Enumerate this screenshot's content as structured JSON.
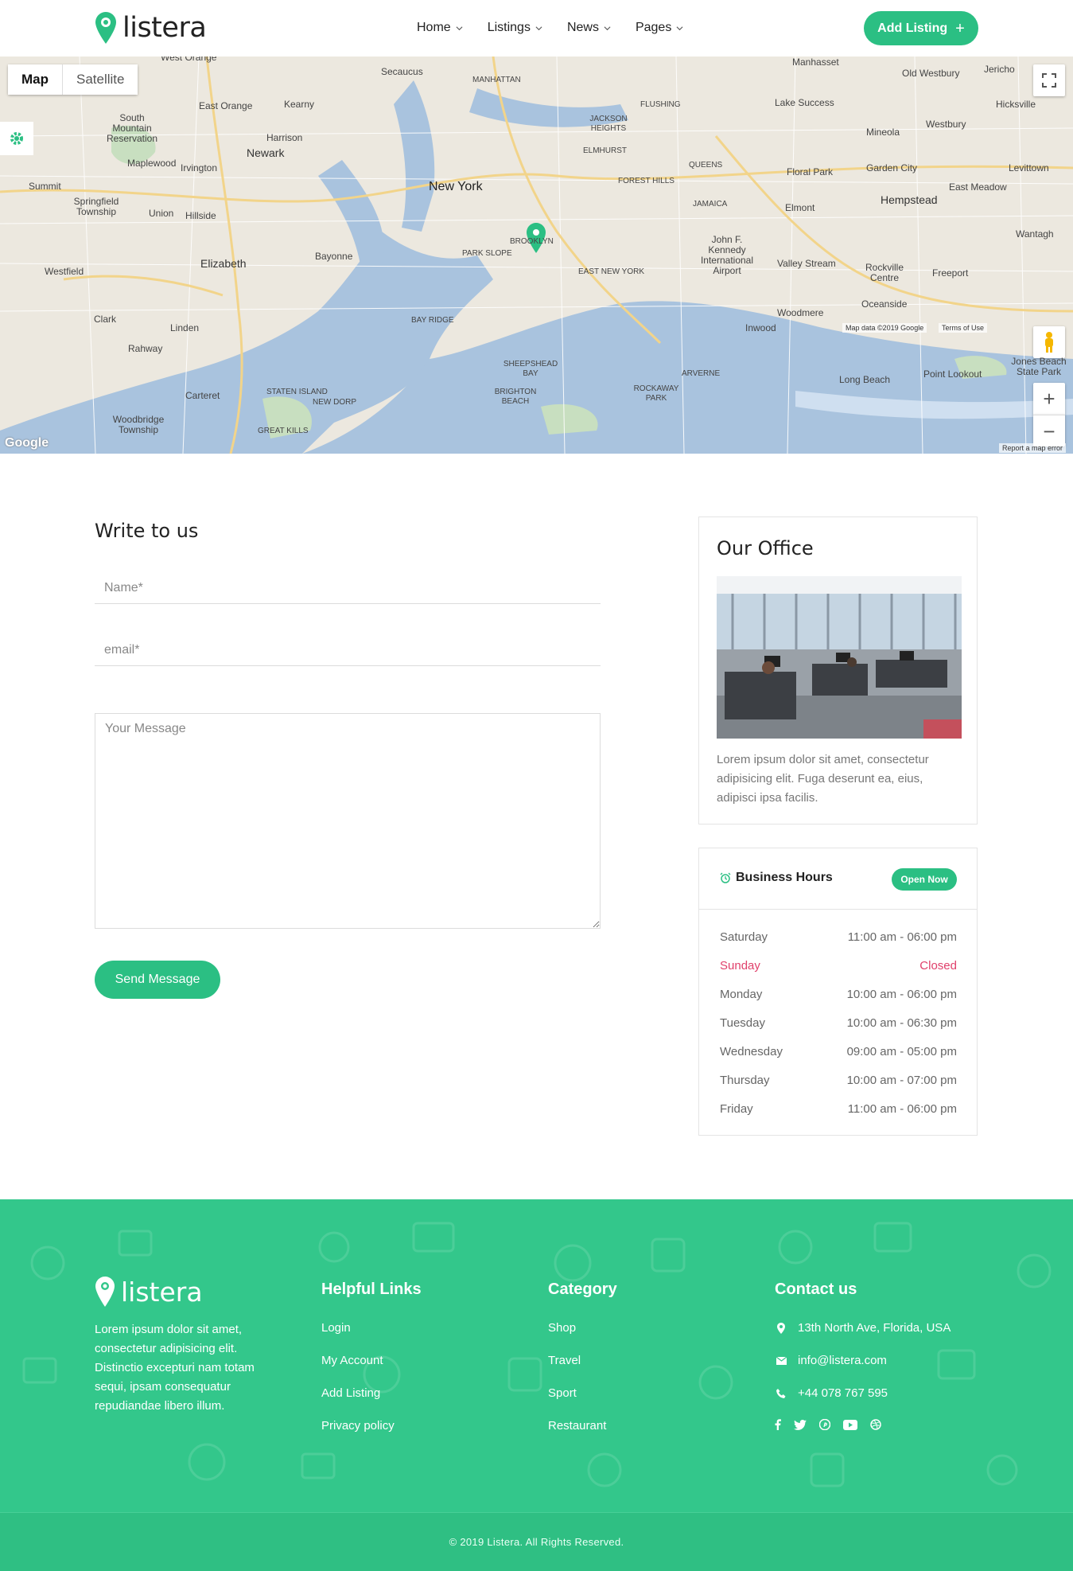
{
  "brand": {
    "name": "listera",
    "accent": "#2bbf83",
    "footer_bg": "#33c78b"
  },
  "nav": {
    "items": [
      {
        "label": "Home"
      },
      {
        "label": "Listings"
      },
      {
        "label": "News"
      },
      {
        "label": "Pages"
      }
    ],
    "add_listing_label": "Add Listing",
    "add_listing_icon": "plus-icon"
  },
  "map": {
    "toggle": {
      "map": "Map",
      "satellite": "Satellite"
    },
    "places": {
      "new_york": "New York",
      "newark": "Newark",
      "elizabeth": "Elizabeth",
      "hempstead": "Hempstead",
      "brooklyn": "BROOKLYN",
      "bayonne": "Bayonne",
      "east_orange": "East Orange",
      "queens": "QUEENS",
      "union": "Union",
      "jfk": "John F. Kennedy International Airport",
      "woodbridge": "Woodbridge Township",
      "long_beach": "Long Beach",
      "valley_stream": "Valley Stream",
      "garden_city": "Garden City",
      "mineola": "Mineola",
      "manhattan": "MANHATTAN",
      "clark": "Clark",
      "linden": "Linden",
      "rahway": "Rahway",
      "carteret": "Carteret",
      "elmont": "Elmont",
      "freeport": "Freeport",
      "oceanside": "Oceanside",
      "rockville_centre": "Rockville Centre",
      "westfield": "Westfield",
      "irvington": "Irvington",
      "kearny": "Kearny",
      "harrison": "Harrison",
      "hicksville": "Hicksville",
      "levittown": "Levittown",
      "lake_success": "Lake Success",
      "westbury": "Westbury",
      "east_meadow": "East Meadow",
      "floral_park": "Floral Park",
      "woodmere": "Woodmere",
      "inwood": "Inwood",
      "wantagh": "Wantagh",
      "jones_beach": "Jones Beach State Park",
      "point_lookout": "Point Lookout",
      "summit": "Summit",
      "maplewood": "Maplewood",
      "springfield": "Springfield Township",
      "south_mountain": "South Mountain Reservation",
      "hillside": "Hillside",
      "jamaica": "JAMAICA",
      "flushing": "FLUSHING",
      "elmhurst": "ELMHURST",
      "jackson_heights": "JACKSON HEIGHTS",
      "forest_hills": "FOREST HILLS",
      "park_slope": "PARK SLOPE",
      "east_new_york": "EAST NEW YORK",
      "bay_ridge": "BAY RIDGE",
      "arverne": "ARVERNE",
      "staten_island": "STATEN ISLAND",
      "sheepshead_bay": "SHEEPSHEAD BAY",
      "brighton_beach": "BRIGHTON BEACH",
      "rockaway_park": "ROCKAWAY PARK",
      "new_dorp": "NEW DORP",
      "great_kills": "GREAT KILLS",
      "manhasset": "Manhasset",
      "old_westbury": "Old Westbury",
      "jericho": "Jericho",
      "west_orange": "West Orange",
      "secaucus": "Secaucus"
    },
    "map_data": "Map data ©2019 Google",
    "terms": "Terms of Use",
    "report": "Report a map error",
    "google": "Google"
  },
  "form": {
    "title": "Write to us",
    "name_placeholder": "Name*",
    "email_placeholder": "email*",
    "message_placeholder": "Your Message",
    "send_label": "Send Message"
  },
  "office": {
    "title": "Our Office",
    "text": "Lorem ipsum dolor sit amet, consectetur adipisicing elit. Fuga deserunt ea, eius, adipisci ipsa facilis."
  },
  "hours": {
    "title": "Business Hours",
    "badge": "Open Now",
    "rows": [
      {
        "day": "Saturday",
        "time": "11:00 am - 06:00 pm"
      },
      {
        "day": "Sunday",
        "time": "Closed"
      },
      {
        "day": "Monday",
        "time": "10:00 am - 06:00 pm"
      },
      {
        "day": "Tuesday",
        "time": "10:00 am - 06:30 pm"
      },
      {
        "day": "Wednesday",
        "time": "09:00 am - 05:00 pm"
      },
      {
        "day": "Thursday",
        "time": "10:00 am - 07:00 pm"
      },
      {
        "day": "Friday",
        "time": "11:00 am - 06:00 pm"
      }
    ],
    "closed_color": "#e0406b"
  },
  "footer": {
    "about": "Lorem ipsum dolor sit amet, consectetur adipisicing elit. Distinctio excepturi nam totam sequi, ipsam consequatur repudiandae libero illum.",
    "helpful": {
      "title": "Helpful Links",
      "links": [
        "Login",
        "My Account",
        "Add Listing",
        "Privacy policy"
      ]
    },
    "category": {
      "title": "Category",
      "links": [
        "Shop",
        "Travel",
        "Sport",
        "Restaurant"
      ]
    },
    "contact": {
      "title": "Contact us",
      "address": "13th North Ave, Florida, USA",
      "email": "info@listera.com",
      "phone": "+44 078 767 595"
    },
    "socials": [
      "facebook-icon",
      "twitter-icon",
      "pinterest-icon",
      "youtube-icon",
      "dribbble-icon"
    ],
    "copyright": "© 2019 Listera. All Rights Reserved."
  }
}
